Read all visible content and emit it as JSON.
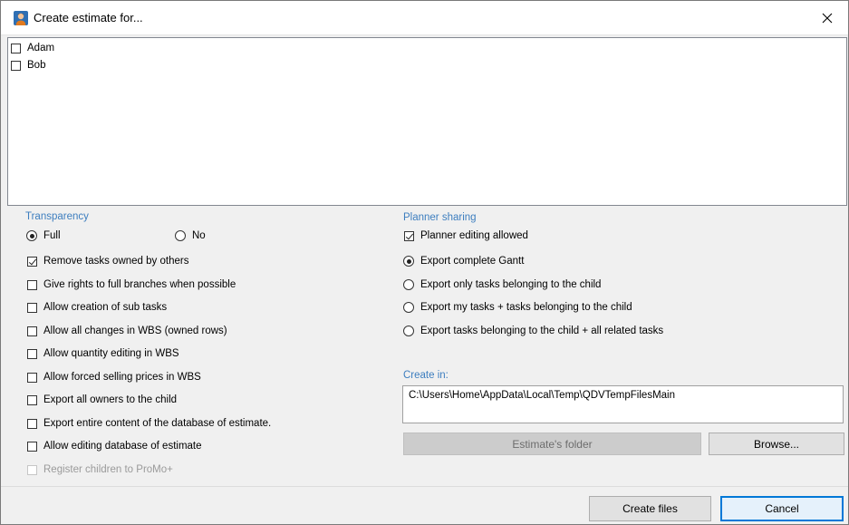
{
  "window": {
    "title": "Create estimate for..."
  },
  "children": [
    {
      "label": "Adam",
      "checked": false
    },
    {
      "label": "Bob",
      "checked": false
    }
  ],
  "transparency": {
    "title": "Transparency",
    "full_label": "Full",
    "no_label": "No",
    "selected": "Full"
  },
  "options": [
    {
      "label": "Remove tasks owned by others",
      "checked": true,
      "enabled": true
    },
    {
      "label": "Give rights to full branches when possible",
      "checked": false,
      "enabled": true
    },
    {
      "label": "Allow creation of sub tasks",
      "checked": false,
      "enabled": true
    },
    {
      "label": "Allow all changes in WBS (owned rows)",
      "checked": false,
      "enabled": true
    },
    {
      "label": "Allow quantity editing in WBS",
      "checked": false,
      "enabled": true
    },
    {
      "label": "Allow forced selling prices in WBS",
      "checked": false,
      "enabled": true
    },
    {
      "label": "Export all owners to the child",
      "checked": false,
      "enabled": true
    },
    {
      "label": "Export entire content of the database of estimate.",
      "checked": false,
      "enabled": true
    },
    {
      "label": "Allow editing database of estimate",
      "checked": false,
      "enabled": true
    },
    {
      "label": "Register children to ProMo+",
      "checked": false,
      "enabled": false
    }
  ],
  "planner": {
    "title": "Planner sharing",
    "editing_label": "Planner editing allowed",
    "editing_checked": true,
    "export_options": [
      {
        "label": "Export complete Gantt",
        "selected": true
      },
      {
        "label": "Export only tasks belonging to the child",
        "selected": false
      },
      {
        "label": "Export my tasks + tasks belonging to the child",
        "selected": false
      },
      {
        "label": "Export tasks belonging to the child + all related tasks",
        "selected": false
      }
    ]
  },
  "create_in": {
    "title": "Create in:",
    "path": "C:\\Users\\Home\\AppData\\Local\\Temp\\QDVTempFilesMain"
  },
  "buttons": {
    "estimates_folder": "Estimate's folder",
    "browse": "Browse...",
    "create_files": "Create files",
    "cancel": "Cancel"
  },
  "colors": {
    "group_title": "#3d7ebf",
    "focus_border": "#0078d7",
    "disabled_button": "#cccccc"
  }
}
